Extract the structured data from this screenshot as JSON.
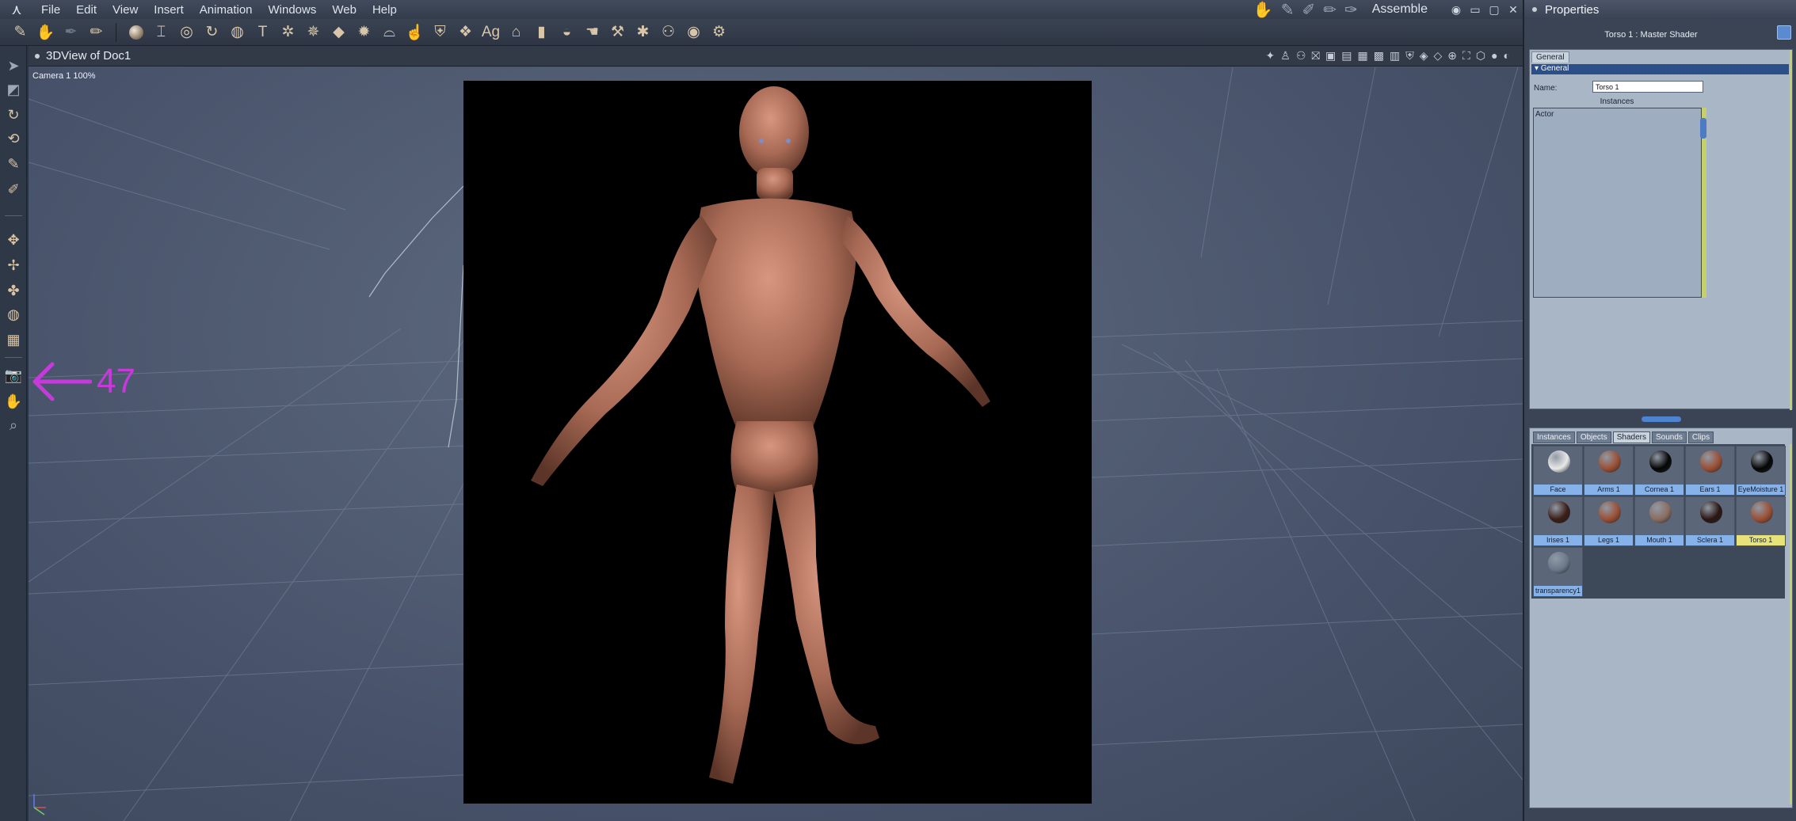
{
  "menubar": {
    "items": [
      "File",
      "Edit",
      "View",
      "Insert",
      "Animation",
      "Windows",
      "Web",
      "Help"
    ],
    "room": "Assemble",
    "controls": [
      "◉",
      "▭",
      "▢",
      "✕"
    ]
  },
  "viewport": {
    "title": "3DView of Doc1",
    "camera_label": "Camera 1 100%"
  },
  "annotation": {
    "arrow": "🡐",
    "label": "47"
  },
  "properties": {
    "panel_title": "Properties",
    "subtitle": "Torso 1 : Master Shader",
    "tab": "General",
    "section": "General",
    "name_label": "Name:",
    "name_value": "Torso 1",
    "instances_label": "Instances",
    "instances": [
      "Actor"
    ]
  },
  "library": {
    "tabs": [
      "Instances",
      "Objects",
      "Shaders",
      "Sounds",
      "Clips"
    ],
    "active_tab": "Shaders",
    "items": [
      {
        "label": "Face",
        "color": "#e8e8e8",
        "selected": false
      },
      {
        "label": "Arms 1",
        "color": "#9a4f34",
        "selected": false
      },
      {
        "label": "Cornea 1",
        "color": "#050505",
        "selected": false
      },
      {
        "label": "Ears 1",
        "color": "#9a4f34",
        "selected": false
      },
      {
        "label": "EyeMoisture 1",
        "color": "#050505",
        "selected": false
      },
      {
        "label": "Irises 1",
        "color": "#3a1d16",
        "selected": false
      },
      {
        "label": "Legs 1",
        "color": "#9a4f34",
        "selected": false
      },
      {
        "label": "Mouth 1",
        "color": "#8b6d60",
        "selected": false
      },
      {
        "label": "Sclera 1",
        "color": "#2a1612",
        "selected": false
      },
      {
        "label": "Torso 1",
        "color": "#9a4f34",
        "selected": true
      },
      {
        "label": "transparency1",
        "color": "#6b7789",
        "selected": false
      }
    ]
  }
}
